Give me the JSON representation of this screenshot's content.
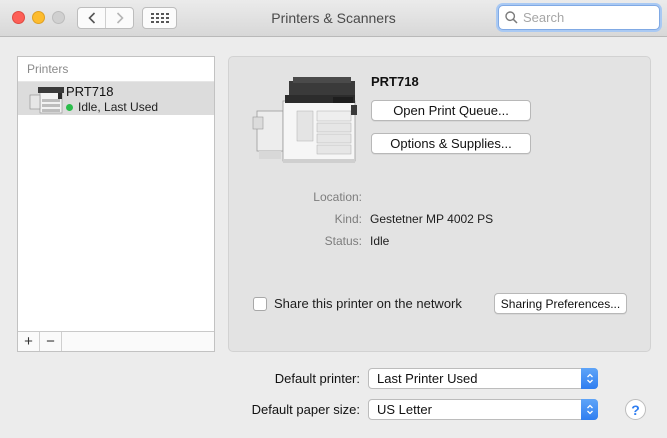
{
  "window": {
    "title": "Printers & Scanners",
    "back_icon": "chevron-left-icon",
    "forward_icon": "chevron-right-icon",
    "grid_icon": "show-all-grid-icon"
  },
  "search": {
    "placeholder": "Search",
    "value": ""
  },
  "printers": {
    "header": "Printers",
    "items": [
      {
        "name": "PRT718",
        "status": "Idle, Last Used",
        "status_color": "#2bbd4b",
        "icon": "printer-icon"
      }
    ],
    "add_label": "+",
    "remove_label": "−"
  },
  "detail": {
    "title": "PRT718",
    "open_queue_label": "Open Print Queue...",
    "options_supplies_label": "Options & Supplies...",
    "location_label": "Location:",
    "location_value": "",
    "kind_label": "Kind:",
    "kind_value": "Gestetner MP 4002 PS",
    "status_label": "Status:",
    "status_value": "Idle",
    "share_label": "Share this printer on the network",
    "share_checked": false,
    "sharing_prefs_label": "Sharing Preferences..."
  },
  "defaults": {
    "printer_label": "Default printer:",
    "printer_value": "Last Printer Used",
    "paper_label": "Default paper size:",
    "paper_value": "US Letter"
  },
  "help": {
    "label": "?"
  },
  "colors": {
    "accent": "#2f7ef0",
    "close": "#fd5f57",
    "minimize": "#fdbc2e",
    "maximize": "#d0d0d0"
  }
}
